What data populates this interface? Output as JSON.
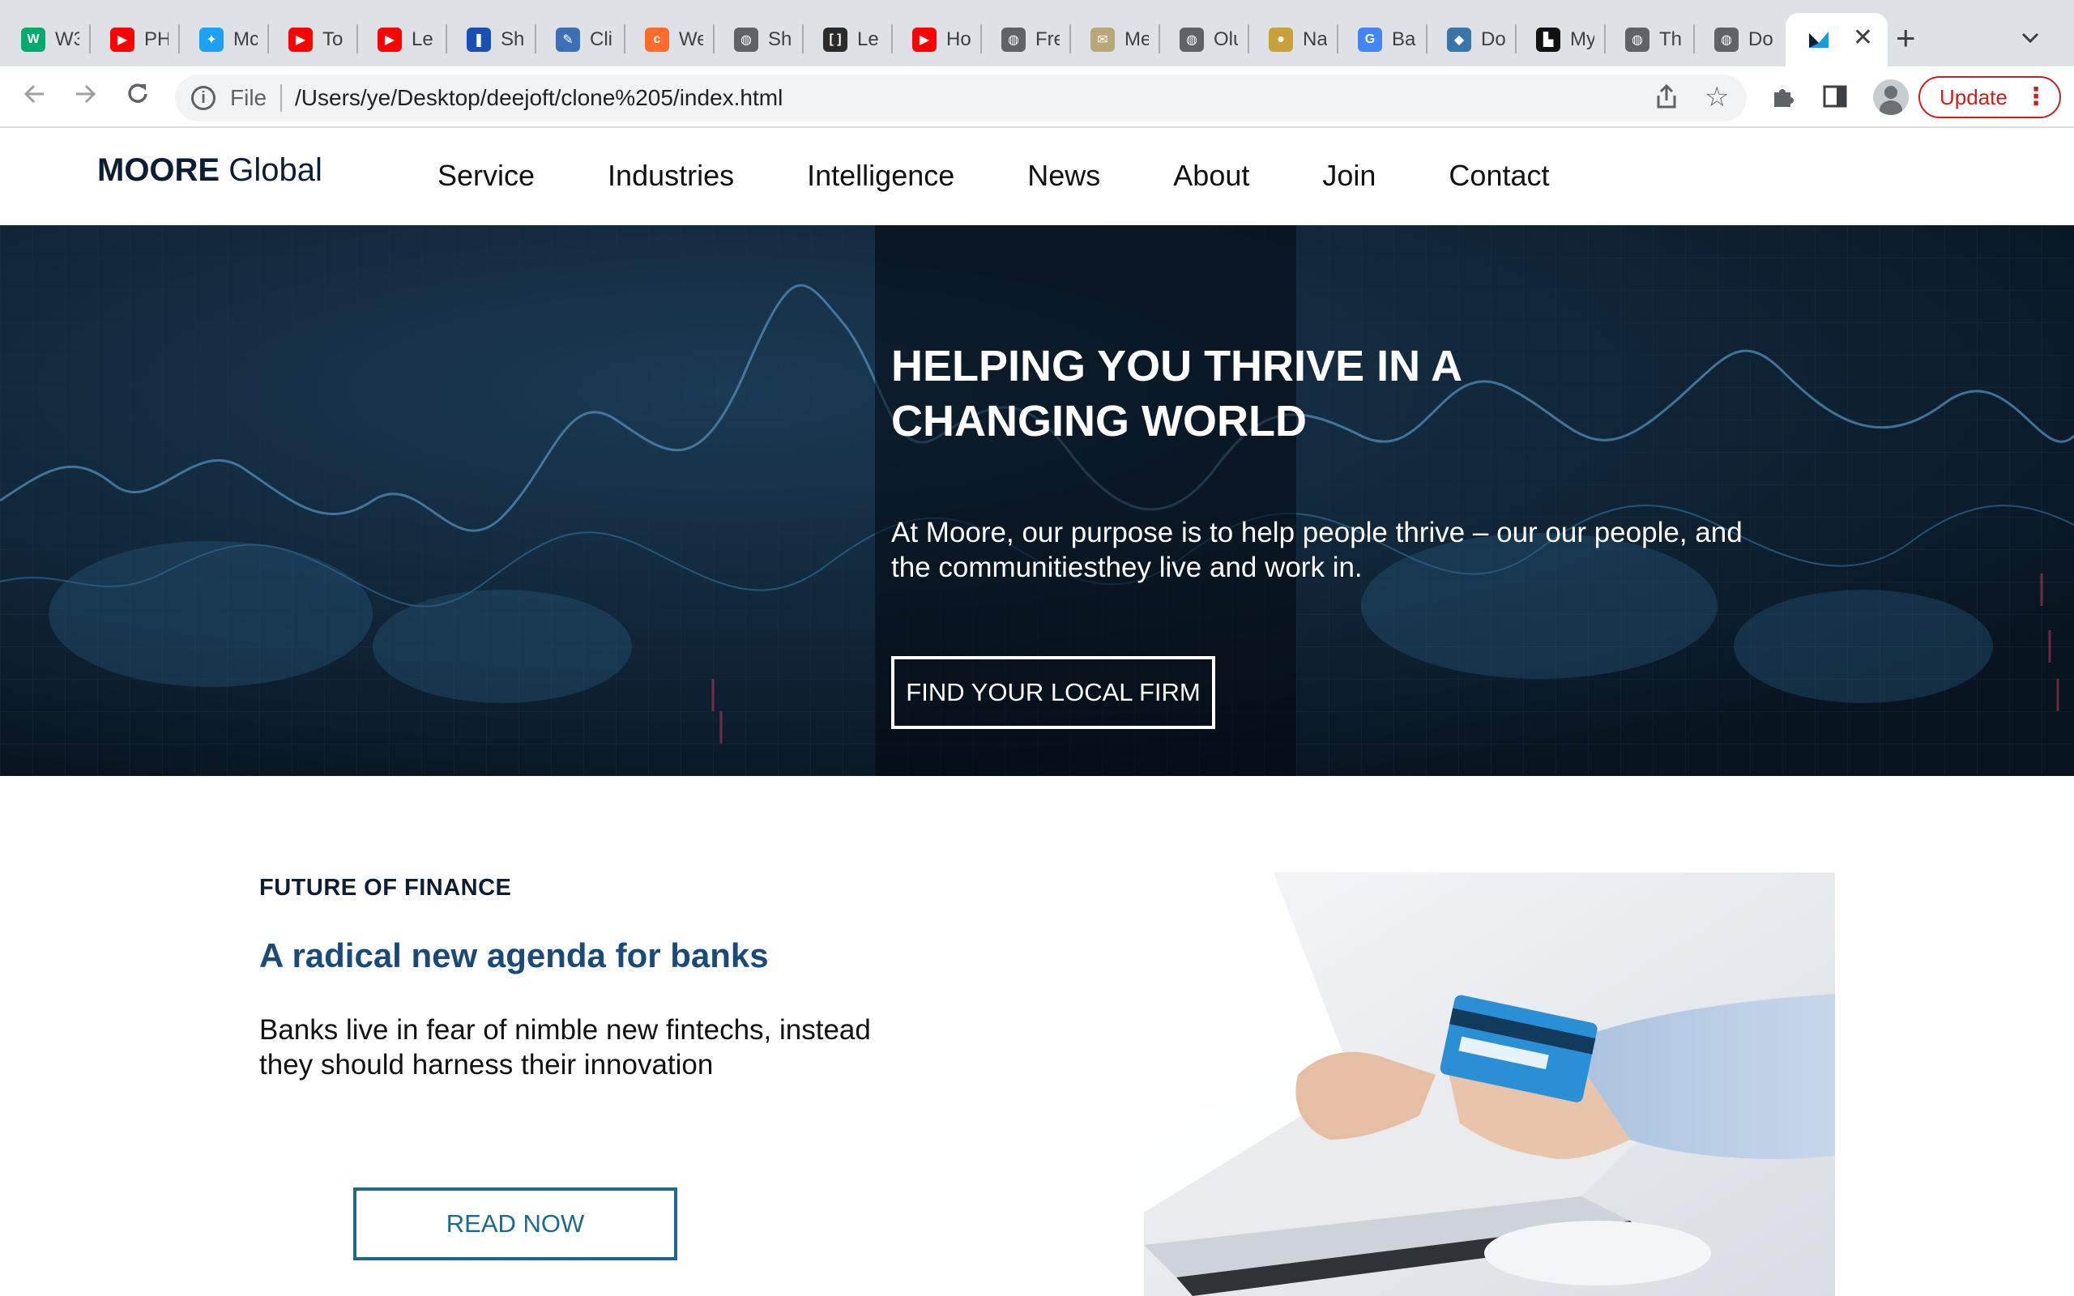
{
  "browser": {
    "tabs": [
      {
        "title": "W3",
        "icon": "w3schools-icon",
        "color": "#04aa6d"
      },
      {
        "title": "PH",
        "icon": "youtube-icon",
        "color": "#ff0000"
      },
      {
        "title": "Mc",
        "icon": "bird-icon",
        "color": "#1da1f2"
      },
      {
        "title": "To",
        "icon": "youtube-icon",
        "color": "#ff0000"
      },
      {
        "title": "Le",
        "icon": "youtube-icon",
        "color": "#ff0000"
      },
      {
        "title": "Sh",
        "icon": "bookmark-icon",
        "color": "#1a4fb4"
      },
      {
        "title": "Cli",
        "icon": "pin-icon",
        "color": "#3d6fb6"
      },
      {
        "title": "We",
        "icon": "cpanel-icon",
        "color": "#ff6c2c"
      },
      {
        "title": "Sh",
        "icon": "globe-icon",
        "color": "#5f6368"
      },
      {
        "title": "Le",
        "icon": "code-icon",
        "color": "#2b2b2b"
      },
      {
        "title": "Ho",
        "icon": "youtube-icon",
        "color": "#ff0000"
      },
      {
        "title": "Fre",
        "icon": "globe-icon",
        "color": "#5f6368"
      },
      {
        "title": "Me",
        "icon": "mail-icon",
        "color": "#b9a77a"
      },
      {
        "title": "Olu",
        "icon": "globe-icon",
        "color": "#5f6368"
      },
      {
        "title": "Na",
        "icon": "coin-icon",
        "color": "#c9a13b"
      },
      {
        "title": "Ba",
        "icon": "google-icon",
        "color": "#4285f4"
      },
      {
        "title": "Do",
        "icon": "python-icon",
        "color": "#3776ab"
      },
      {
        "title": "My",
        "icon": "blocks-icon",
        "color": "#111111"
      },
      {
        "title": "Th",
        "icon": "globe-icon",
        "color": "#5f6368"
      },
      {
        "title": "Do",
        "icon": "globe-icon",
        "color": "#5f6368"
      }
    ],
    "active_tab_icon": "moore-logo-icon",
    "omnibox": {
      "scheme_label": "File",
      "url": "/Users/ye/Desktop/deejoft/clone%205/index.html"
    },
    "update_label": "Update"
  },
  "site": {
    "logo_brand": "MOORE",
    "logo_suffix": " Global",
    "nav": [
      "Service",
      "Industries",
      "Intelligence",
      "News",
      "About",
      "Join",
      "Contact"
    ],
    "hero": {
      "title": "HELPING YOU THRIVE IN A CHANGING WORLD",
      "text": "At Moore, our purpose is to help people thrive – our our people, and the communitiesthey live and work in.",
      "button": "FIND YOUR LOCAL FIRM"
    },
    "article": {
      "kicker": "FUTURE OF FINANCE",
      "headline": "A radical new agenda for banks",
      "summary": "Banks live in fear of nimble new fintechs, instead they should harness their innovation",
      "button": "READ NOW"
    },
    "colors": {
      "headline": "#1a4a78",
      "read_button": "#1d6a8c",
      "hero_bg": "#0b1b2c",
      "update": "#c5221f"
    }
  }
}
